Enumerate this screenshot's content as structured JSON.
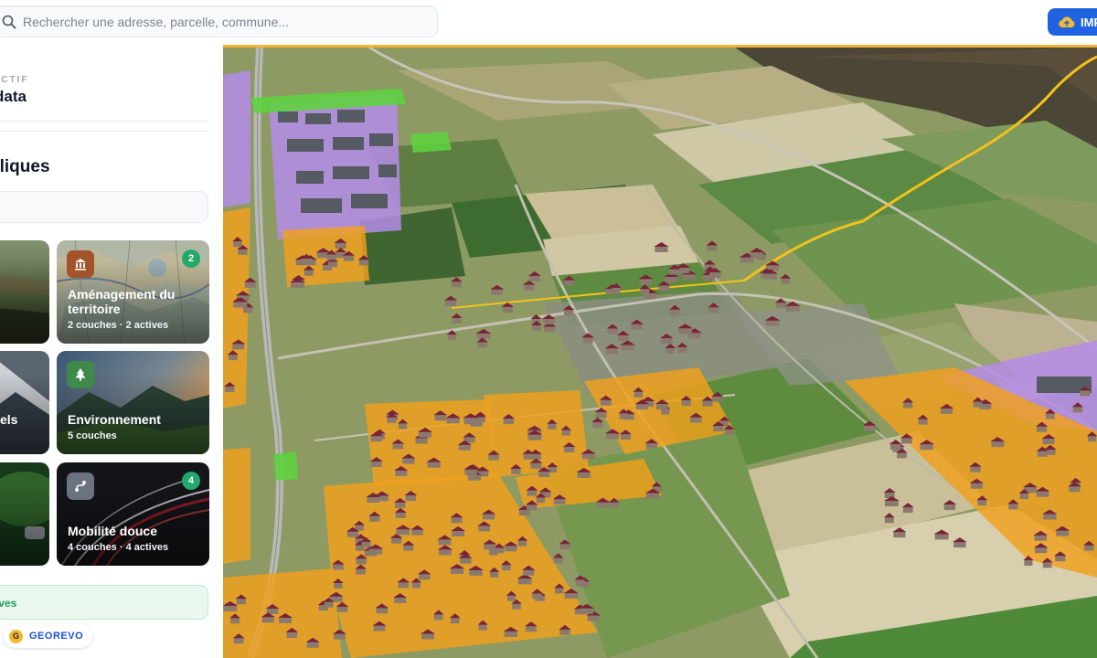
{
  "search": {
    "placeholder": "Rechercher une adresse, parcelle, commune..."
  },
  "toolbar": {
    "import_label": "IMP"
  },
  "sidebar": {
    "mode_label": "ACTIF",
    "mode_value": "data",
    "section_title": "bliques",
    "cards": [
      {
        "title": "",
        "subtitle": ""
      },
      {
        "title": "Aménagement du territoire",
        "subtitle": "2 couches · 2 actives",
        "badge": "2",
        "icon": "bank-icon"
      },
      {
        "title": "els",
        "subtitle": ""
      },
      {
        "title": "Environnement",
        "subtitle": "5 couches",
        "icon": "tree-icon"
      },
      {
        "title": "",
        "subtitle": ""
      },
      {
        "title": "Mobilité douce",
        "subtitle": "4 couches · 4 actives",
        "badge": "4",
        "icon": "route-icon"
      }
    ],
    "active_summary": "ives",
    "brand": {
      "letter": "G",
      "name": "GEOREVO"
    }
  },
  "colors": {
    "accent": "#1f63e0",
    "map_border": "#f2b533",
    "zone_orange": "#f2a01c",
    "zone_purple": "#b48ce8",
    "zone_green": "#5ed13f",
    "badge": "#22a96b"
  }
}
